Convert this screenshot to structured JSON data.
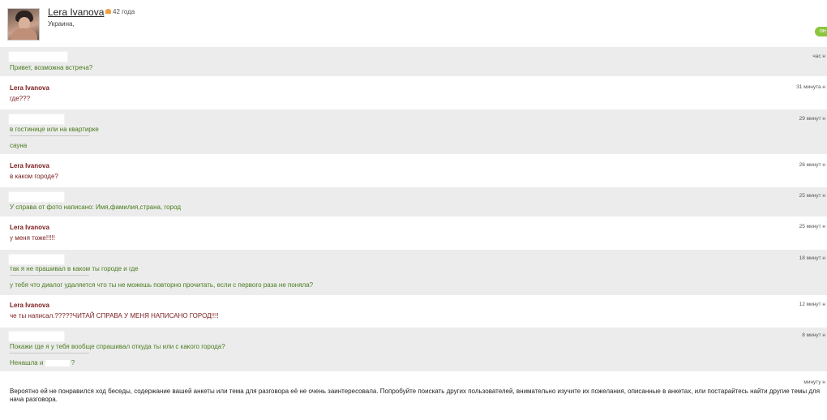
{
  "profile": {
    "name": "Lera Ivanova",
    "age": "42 года",
    "location": "Украина,",
    "online_label": "он"
  },
  "messages": [
    {
      "from": "other",
      "author": "",
      "time": "час н",
      "lines": [
        "Привет, возможна встреча?"
      ]
    },
    {
      "from": "me",
      "author": "Lera Ivanova",
      "time": "31 минута н",
      "lines": [
        "где???"
      ]
    },
    {
      "from": "other",
      "author": "",
      "time": "29 минут н",
      "lines": [
        "в гостинице или на квартирке",
        "сауна"
      ]
    },
    {
      "from": "me",
      "author": "Lera Ivanova",
      "time": "26 минут н",
      "lines": [
        "в каком городе?"
      ]
    },
    {
      "from": "other",
      "author": "",
      "time": "25 минут н",
      "lines": [
        "У справа от фото написано: Имя,фамилия,страна, город"
      ]
    },
    {
      "from": "me",
      "author": "Lera Ivanova",
      "time": "25 минут н",
      "lines": [
        "у меня тоже!!!!!"
      ]
    },
    {
      "from": "other",
      "author": "",
      "time": "18 минут н",
      "lines": [
        "так я не прашивал в каком ты городе и где",
        "у тебя что диалог удаляется что ты не можешь повторно прочитать, если с первого раза не поняла?"
      ]
    },
    {
      "from": "me",
      "author": "Lera Ivanova",
      "time": "12 минут н",
      "lines": [
        "че ты написал.?????ЧИТАЙ СПРАВА У МЕНЯ НАПИСАНО ГОРОД!!!!"
      ]
    },
    {
      "from": "other",
      "author": "",
      "time": "8 минут н",
      "lines": [
        "Покажи где я у тебя вообще спрашивал откуда ты или с какого города?",
        "Ненашла и",
        "?"
      ]
    }
  ],
  "footer": {
    "time": "минуту н",
    "notice": "Вероятно ей не понравился ход беседы, содержание вашей анкеты или тема для разговора её не очень заинтересовала. Попробуйте поискать других пользователей, внимательно изучите их пожелания, описанные в анкетах, или постарайтесь найти другие темы для нача разговора."
  }
}
